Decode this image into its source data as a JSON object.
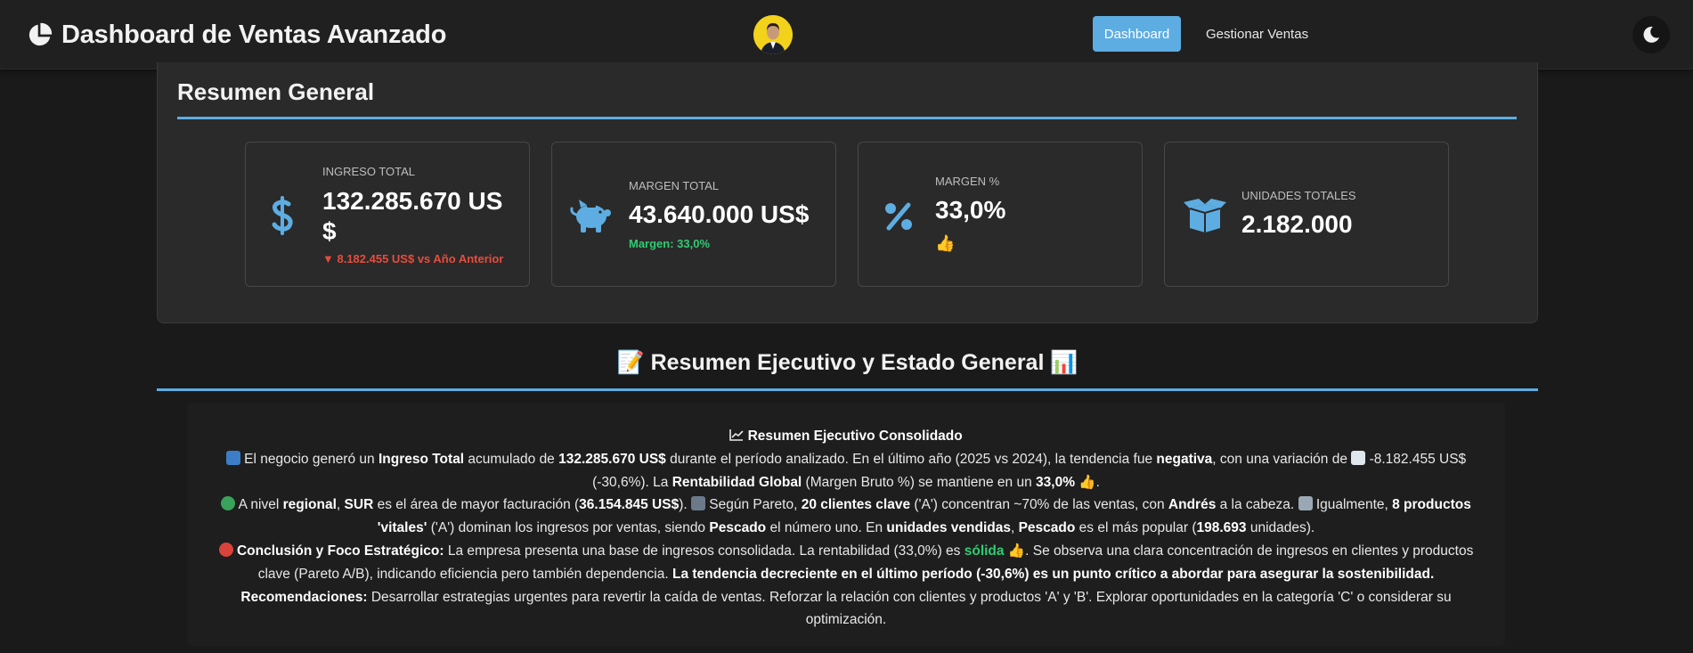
{
  "navbar": {
    "title": "Dashboard de Ventas Avanzado",
    "nav": {
      "dashboard": "Dashboard",
      "manage": "Gestionar Ventas"
    }
  },
  "summary": {
    "title": "Resumen General",
    "kpis": {
      "revenue": {
        "label": "INGRESO TOTAL",
        "value_line1": "132.285.670 US",
        "value_line2": "$",
        "sub": "▼ 8.182.455 US$ vs Año Anterior"
      },
      "margin": {
        "label": "MARGEN TOTAL",
        "value": "43.640.000 US$",
        "sub": "Margen: 33,0%"
      },
      "margin_pct": {
        "label": "MARGEN %",
        "value": "33,0%",
        "emoji": "👍"
      },
      "units": {
        "label": "UNIDADES TOTALES",
        "value": "2.182.000"
      }
    },
    "colors": {
      "accent": "#5dade2",
      "negative": "#e74c3c",
      "positive": "#2ecc71"
    }
  },
  "executive": {
    "title": "📝 Resumen Ejecutivo y Estado General 📊",
    "heading": "Resumen Ejecutivo Consolidado",
    "p1": {
      "t1": "El negocio generó un ",
      "b1": "Ingreso Total",
      "t2": " acumulado de ",
      "b2": "132.285.670 US$",
      "t3": " durante el período analizado. En el último año (2025 vs 2024), la tendencia fue ",
      "b3": "negativa",
      "t4": ", con una variación de ",
      "t5": " -8.182.455 US$ (-30,6%). La ",
      "b4": "Rentabilidad Global",
      "t6": " (Margen Bruto %) se mantiene en un ",
      "b5": "33,0%",
      "t7": " 👍."
    },
    "p2": {
      "t1": " A nivel ",
      "b1": "regional",
      "t2": ", ",
      "b2": "SUR",
      "t3": " es el área de mayor facturación (",
      "b3": "36.154.845 US$",
      "t4": "). ",
      "t5": " Según Pareto, ",
      "b4": "20 clientes clave",
      "t6": " ('A') concentran ~70% de las ventas, con ",
      "b5": "Andrés",
      "t7": " a la cabeza. ",
      "t8": " Igualmente, ",
      "b6": "8 productos 'vitales'",
      "t9": " ('A') dominan los ingresos por ventas, siendo ",
      "b7": "Pescado",
      "t10": " el número uno. En ",
      "b8": "unidades vendidas",
      "t11": ", ",
      "b9": "Pescado",
      "t12": " es el más popular (",
      "b10": "198.693",
      "t13": " unidades)."
    },
    "p3": {
      "b1": "Conclusión y Foco Estratégico:",
      "t1": " La empresa presenta una base de ingresos consolidada. La rentabilidad (33,0%) es ",
      "b2": "sólida",
      "t2": " 👍. Se observa una clara concentración de ingresos en clientes y productos clave (Pareto A/B), indicando eficiencia pero también dependencia. ",
      "b3": "La tendencia decreciente en el último período (-30,6%) es un punto crítico a abordar para asegurar la sostenibilidad."
    },
    "p4": {
      "b1": "Recomendaciones:",
      "t1": " Desarrollar estrategias urgentes para revertir la caída de ventas. Reforzar la relación con clientes y productos 'A' y 'B'. Explorar oportunidades en la categoría 'C' o considerar su optimización."
    }
  }
}
